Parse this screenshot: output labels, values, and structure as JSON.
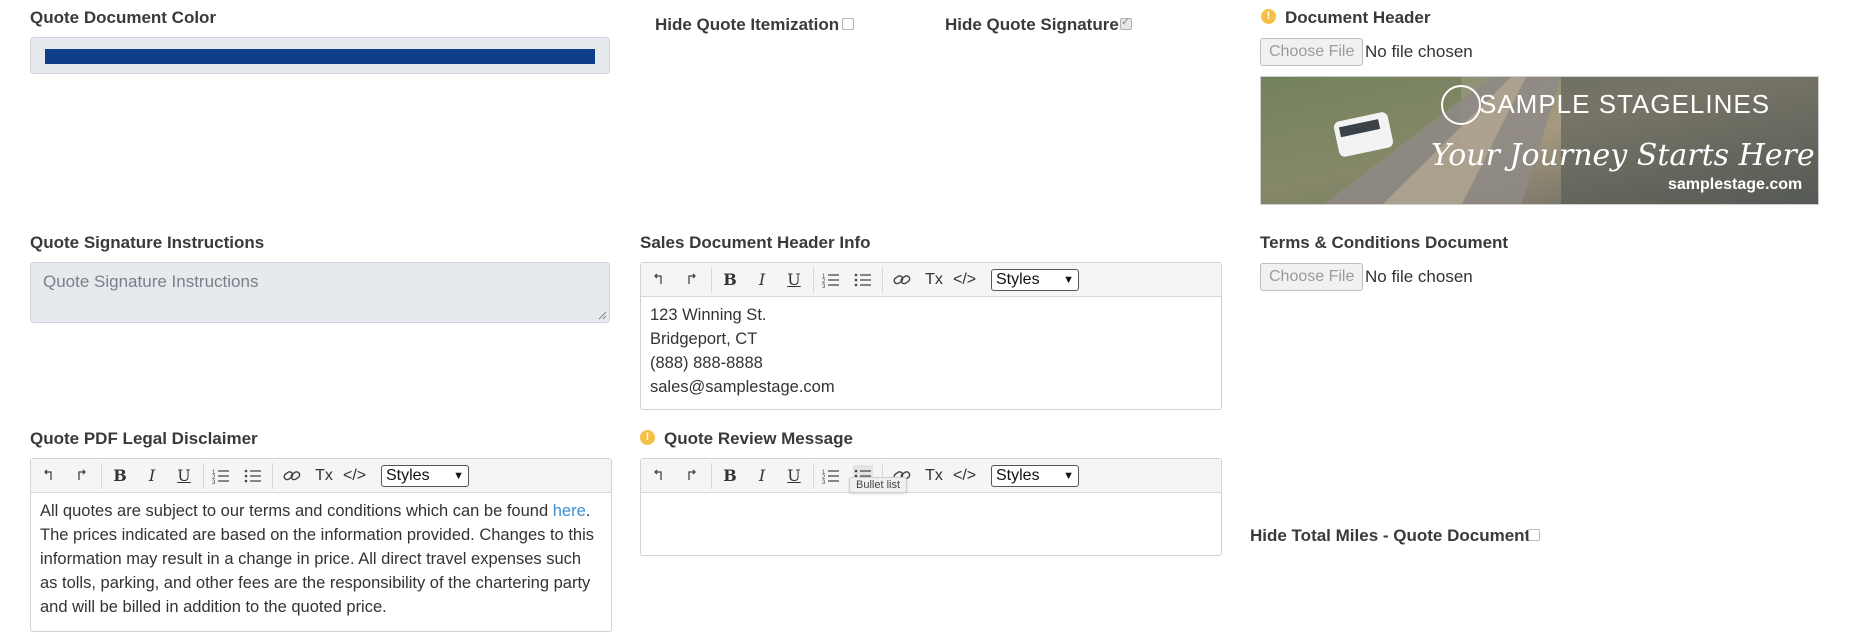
{
  "quote_document_color": {
    "label": "Quote Document Color",
    "color": "#0e3e87"
  },
  "hide_quote_itemization": {
    "label": "Hide Quote Itemization",
    "checked": false
  },
  "hide_quote_signature": {
    "label": "Hide Quote Signature",
    "checked": true
  },
  "document_header": {
    "label": "Document Header",
    "file_button": "Choose File",
    "file_status": "No file chosen",
    "image": {
      "brand": "SAMPLE STAGELINES",
      "tagline": "Your Journey Starts Here",
      "website": "samplestage.com"
    }
  },
  "quote_signature_instructions": {
    "label": "Quote Signature Instructions",
    "placeholder": "Quote Signature Instructions"
  },
  "sales_document_header_info": {
    "label": "Sales Document Header Info",
    "lines": [
      "123 Winning St.",
      "Bridgeport, CT",
      "(888) 888-8888",
      "sales@samplestage.com"
    ]
  },
  "terms_conditions_document": {
    "label": "Terms & Conditions Document",
    "file_button": "Choose File",
    "file_status": "No file chosen"
  },
  "quote_pdf_legal_disclaimer": {
    "label": "Quote PDF Legal Disclaimer",
    "text_before_link": "All quotes are subject to our terms and conditions which can be found ",
    "link_text": "here",
    "text_after_link": ". The prices indicated are based on the information provided. Changes to this information may result in a change in price. All direct travel expenses such as tolls, parking, and other fees are the responsibility of the chartering party and will be billed in addition to the quoted price."
  },
  "quote_review_message": {
    "label": "Quote Review Message",
    "tooltip": "Bullet list"
  },
  "hide_total_miles": {
    "label": "Hide Total Miles - Quote Document",
    "checked": false
  },
  "editor_toolbar": {
    "styles_label": "Styles",
    "clear_format_label": "Tx",
    "source_label": "</>",
    "bold": "B",
    "italic": "I",
    "underline": "U"
  },
  "colors": {
    "info": "#f6c044",
    "link": "#3b8fd0",
    "field_bg": "#e6e9ee"
  }
}
